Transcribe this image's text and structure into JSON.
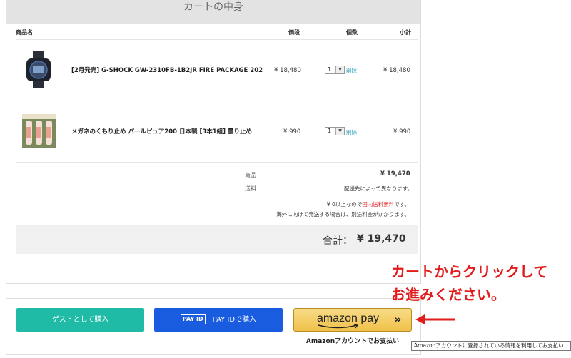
{
  "cart": {
    "title": "カートの中身",
    "columns": {
      "name": "商品名",
      "price": "価段",
      "qty": "個数",
      "subtotal": "小計"
    },
    "items": [
      {
        "name": "[2月発売] G-SHOCK GW-2310FB-1B2JR FIRE PACKAGE 202",
        "price": "¥ 18,480",
        "qty": "1",
        "delete": "削除",
        "subtotal": "¥ 18,480",
        "image": "watch-image"
      },
      {
        "name": "メガネのくもり止め パールピュア200 日本製 [3本1組] 曇り止め",
        "price": "¥ 990",
        "qty": "1",
        "delete": "削除",
        "subtotal": "¥ 990",
        "image": "antifog-bottles-image"
      }
    ],
    "summary": {
      "products_label": "商品",
      "products_value": "¥ 19,470",
      "shipping_label": "送料",
      "shipping_value": "配送先によって異なります。",
      "note1_prefix": "¥ 0以上なので",
      "note1_highlight": "国内送料無料",
      "note1_suffix": "です。",
      "note2": "海外に向けて発送する場合は、別途料金がかかります。"
    },
    "total": {
      "label": "合計：",
      "value": "¥ 19,470"
    }
  },
  "payment": {
    "guest_button": "ゲストとして購入",
    "payid_logo": "PAY ID",
    "payid_button": "PAY IDで購入",
    "amazon_button": "amazon pay",
    "amazon_caption": "Amazonアカウントでお支払い",
    "tooltip": "Amazonアカウントに登録されている情報を利用してお支払い"
  },
  "annotation": {
    "line1": "カートからクリックして",
    "line2": "お進みください。"
  },
  "colors": {
    "guest": "#1fbba6",
    "payid": "#1a5ce0",
    "amazon": "#f0c14b",
    "annotation": "#e21b1b",
    "highlight": "#e21b1b"
  }
}
